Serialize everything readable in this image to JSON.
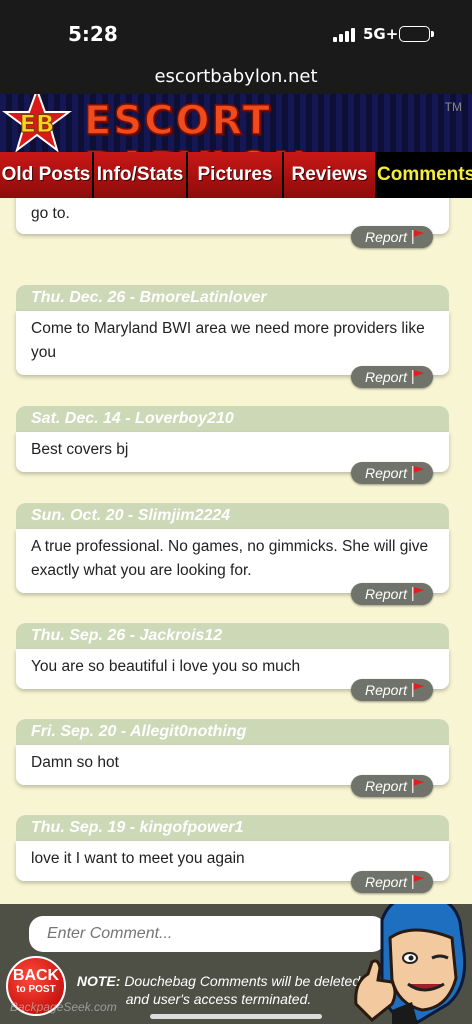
{
  "status_bar": {
    "time": "5:28",
    "network": "5G+"
  },
  "browser": {
    "url": "escortbabylon.net"
  },
  "header": {
    "logo_badge": "EB",
    "site_name": "ESCORT BABYLON",
    "trademark": "TM"
  },
  "nav": {
    "tabs": [
      {
        "label": "Old Posts"
      },
      {
        "label": "Info/Stats"
      },
      {
        "label": "Pictures"
      },
      {
        "label": "Reviews"
      },
      {
        "label": "Comments"
      }
    ],
    "active": "Comments"
  },
  "comments": [
    {
      "date": "",
      "user": "",
      "text": "Gorgeous woman. Very satisfying. Head on point. My new go to.",
      "report_label": "Report"
    },
    {
      "date": "Thu. Dec. 26",
      "user": "BmoreLatinlover",
      "text": "Come to Maryland BWI area we need more providers like you",
      "report_label": "Report"
    },
    {
      "date": "Sat. Dec. 14",
      "user": "Loverboy210",
      "text": "Best covers bj",
      "report_label": "Report"
    },
    {
      "date": "Sun. Oct. 20",
      "user": "Slimjim2224",
      "text": "A true professional. No games, no gimmicks. She will give exactly what you are looking for.",
      "report_label": "Report"
    },
    {
      "date": "Thu. Sep. 26",
      "user": "Jackrois12",
      "text": "You are so beautiful i love you so much",
      "report_label": "Report"
    },
    {
      "date": "Fri. Sep. 20",
      "user": "Allegit0nothing",
      "text": "Damn so hot",
      "report_label": "Report"
    },
    {
      "date": "Thu. Sep. 19",
      "user": "kingofpower1",
      "text": "love it I want to meet you again",
      "report_label": "Report"
    }
  ],
  "footer": {
    "comment_placeholder": "Enter Comment...",
    "back_line1": "BACK",
    "back_line2": "to POST",
    "note_label": "NOTE:",
    "note_text": "Douchebag Comments will be deleted and user's access terminated.",
    "watermark": "BackpageSeek.com"
  },
  "colors": {
    "nav_red": "#c91717",
    "active_tab_text": "#f6ed3a",
    "card_header": "#cdd9b6",
    "page_bg": "#f8f5d3",
    "footer_bg": "#4f5045",
    "report_pill": "#6f7369"
  }
}
